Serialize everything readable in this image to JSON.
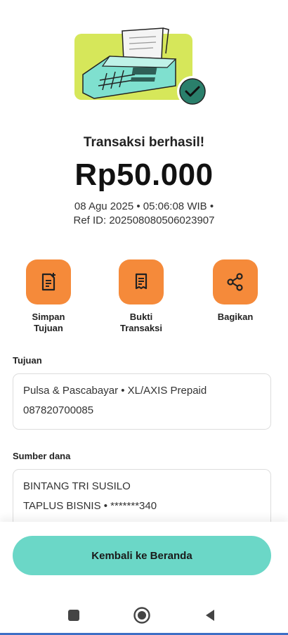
{
  "result": {
    "title": "Transaksi berhasil!",
    "amount": "Rp50.000",
    "datetime": "08 Agu 2025 • 05:06:08 WIB •",
    "ref": "Ref ID: 202508080506023907"
  },
  "actions": [
    {
      "line1": "Simpan",
      "line2": "Tujuan",
      "icon": "save-note-icon"
    },
    {
      "line1": "Bukti",
      "line2": "Transaksi",
      "icon": "receipt-icon"
    },
    {
      "line1": "Bagikan",
      "line2": "",
      "icon": "share-icon"
    }
  ],
  "tujuan": {
    "label": "Tujuan",
    "line1": "Pulsa & Pascabayar • XL/AXIS Prepaid",
    "line2": "087820700085"
  },
  "sumber": {
    "label": "Sumber dana",
    "line1": "BINTANG TRI SUSILO",
    "line2": "TAPLUS BISNIS • *******340"
  },
  "footer": {
    "home_button": "Kembali ke Beranda"
  },
  "navbar": {
    "items": [
      "recent-apps-icon",
      "home-circle-icon",
      "back-triangle-icon"
    ]
  },
  "colors": {
    "accent_orange": "#f58a3a",
    "accent_teal": "#6bd7c7",
    "check_green": "#2a7f6b",
    "illustration_lime": "#d6e75a"
  }
}
